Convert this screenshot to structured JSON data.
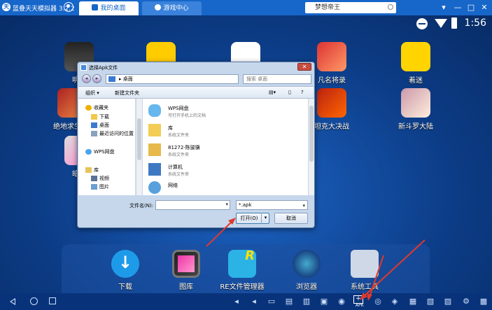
{
  "topbar": {
    "app_title": "蓝叠天天模拟器 3.2.2",
    "logo": "天",
    "tabs": [
      {
        "label": "我的桌面",
        "active": true
      },
      {
        "label": "游戏中心",
        "active": false
      }
    ],
    "search_value": "梦想帝王",
    "window_controls": [
      "▾",
      "—",
      "□",
      "✕"
    ]
  },
  "status": {
    "time": "1:56"
  },
  "desktop_apps": [
    {
      "label": "明日",
      "icon": "ghost-app-icon"
    },
    {
      "label": "",
      "icon": "bee-app-icon"
    },
    {
      "label": "",
      "icon": "qq-icon"
    },
    {
      "label": "凡名将录",
      "icon": "hero-game-icon"
    },
    {
      "label": "着迷",
      "icon": "chicken-app-icon"
    },
    {
      "label": "绝地求生",
      "icon": "pubg-icon"
    },
    {
      "label": "坦克大决战",
      "icon": "tank-game-icon"
    },
    {
      "label": "新斗罗大陆",
      "icon": "douluo-icon"
    },
    {
      "label": "暗黑",
      "icon": "dark-game-icon"
    }
  ],
  "dock_apps": [
    {
      "label": "下载"
    },
    {
      "label": "图库"
    },
    {
      "label": "RE文件管理器"
    },
    {
      "label": "浏览器"
    },
    {
      "label": "系统工具"
    }
  ],
  "navbar": {
    "apk_label": "APK",
    "apk_btn": "+"
  },
  "dialog": {
    "title": "选择Apk文件",
    "close": "✕",
    "address": "桌面",
    "address_arrow": "▸",
    "search_placeholder": "搜索 桌面",
    "toolbar": {
      "organize": "组织 ▾",
      "new_folder": "新建文件夹"
    },
    "sidebar": [
      {
        "label": "收藏夹",
        "icon": "star"
      },
      {
        "label": "下载",
        "icon": "folder"
      },
      {
        "label": "桌面",
        "icon": "desk"
      },
      {
        "label": "最近访问的位置",
        "icon": "recent"
      },
      {
        "label": "WPS网盘",
        "icon": "cloud"
      },
      {
        "label": "库",
        "icon": "lib"
      },
      {
        "label": "视频",
        "icon": "vid"
      },
      {
        "label": "图片",
        "icon": "pic"
      }
    ],
    "files": [
      {
        "name": "WPS网盘",
        "desc": "可打开手机上的文档",
        "icon": "cloudb"
      },
      {
        "name": "库",
        "desc": "系统文件夹",
        "icon": "libf"
      },
      {
        "name": "81272-陈骏骥",
        "desc": "系统文件夹",
        "icon": "userf"
      },
      {
        "name": "计算机",
        "desc": "系统文件夹",
        "icon": "pc"
      },
      {
        "name": "网络",
        "desc": "",
        "icon": "net"
      }
    ],
    "filename_label": "文件名(N):",
    "filename_value": "",
    "filetype": "*.apk",
    "open_label": "打开(O)",
    "cancel_label": "取消"
  },
  "colors": {
    "accent": "#1766c9",
    "arrow": "#e0392c"
  }
}
